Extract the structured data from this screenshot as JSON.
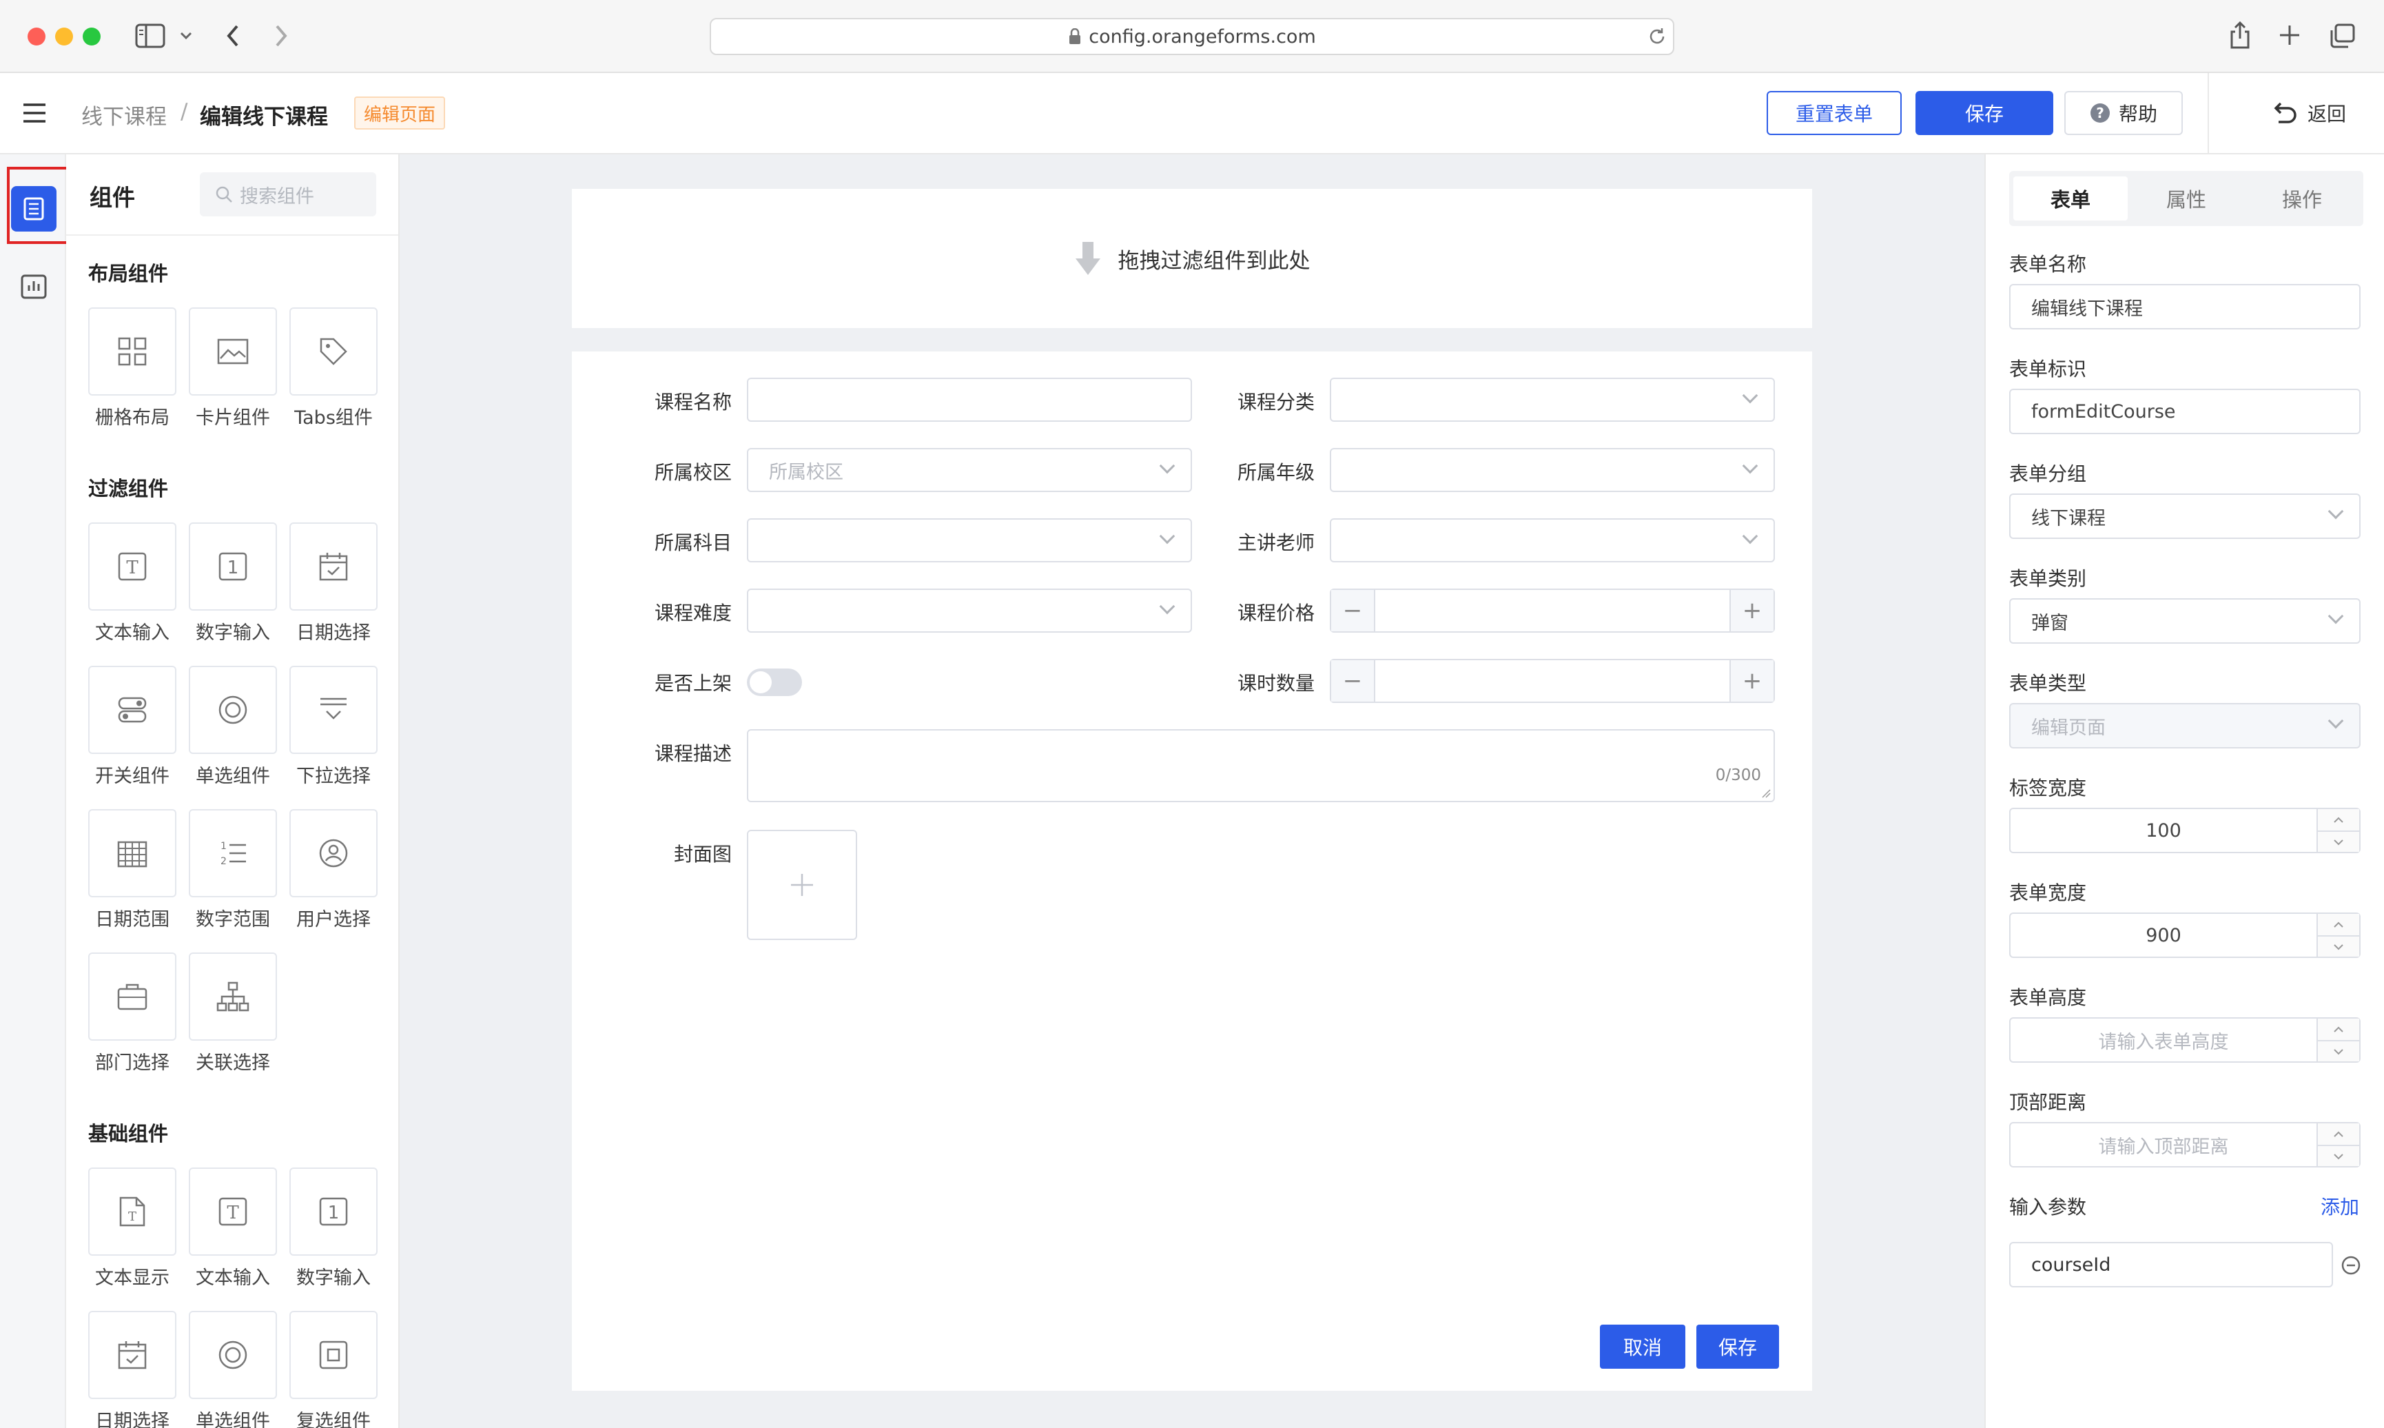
{
  "browser": {
    "url": "config.orangeforms.com"
  },
  "header": {
    "breadcrumb_parent": "线下课程",
    "breadcrumb_sep": "/",
    "breadcrumb_current": "编辑线下课程",
    "page_tag": "编辑页面",
    "reset_label": "重置表单",
    "save_label": "保存",
    "help_label": "帮助",
    "back_label": "返回"
  },
  "component_panel": {
    "title": "组件",
    "search_placeholder": "搜索组件",
    "sections": [
      {
        "title": "布局组件",
        "items": [
          "栅格布局",
          "卡片组件",
          "Tabs组件"
        ]
      },
      {
        "title": "过滤组件",
        "items": [
          "文本输入",
          "数字输入",
          "日期选择",
          "开关组件",
          "单选组件",
          "下拉选择",
          "日期范围",
          "数字范围",
          "用户选择",
          "部门选择",
          "关联选择"
        ]
      },
      {
        "title": "基础组件",
        "items": [
          "文本显示",
          "文本输入",
          "数字输入",
          "日期选择",
          "单选组件",
          "复选组件"
        ]
      }
    ]
  },
  "canvas": {
    "drop_hint": "拖拽过滤组件到此处",
    "fields": {
      "course_name": "课程名称",
      "course_category": "课程分类",
      "campus": "所属校区",
      "campus_placeholder": "所属校区",
      "grade": "所属年级",
      "subject": "所属科目",
      "teacher": "主讲老师",
      "difficulty": "课程难度",
      "price": "课程价格",
      "on_shelf": "是否上架",
      "hours": "课时数量",
      "description": "课程描述",
      "desc_counter": "0/300",
      "cover": "封面图"
    },
    "cancel_label": "取消",
    "save_label": "保存"
  },
  "right_panel": {
    "tabs": [
      "表单",
      "属性",
      "操作"
    ],
    "active_tab": "表单",
    "form_name_label": "表单名称",
    "form_name_value": "编辑线下课程",
    "form_id_label": "表单标识",
    "form_id_value": "formEditCourse",
    "form_group_label": "表单分组",
    "form_group_value": "线下课程",
    "form_category_label": "表单类别",
    "form_category_value": "弹窗",
    "form_type_label": "表单类型",
    "form_type_value": "编辑页面",
    "label_width_label": "标签宽度",
    "label_width_value": "100",
    "form_width_label": "表单宽度",
    "form_width_value": "900",
    "form_height_label": "表单高度",
    "form_height_placeholder": "请输入表单高度",
    "top_distance_label": "顶部距离",
    "top_distance_placeholder": "请输入顶部距离",
    "input_params_label": "输入参数",
    "add_label": "添加",
    "param_value": "courseId"
  },
  "colors": {
    "primary": "#2c5ce8",
    "tag_orange": "#f58a2e",
    "highlight_red": "#e02424"
  }
}
